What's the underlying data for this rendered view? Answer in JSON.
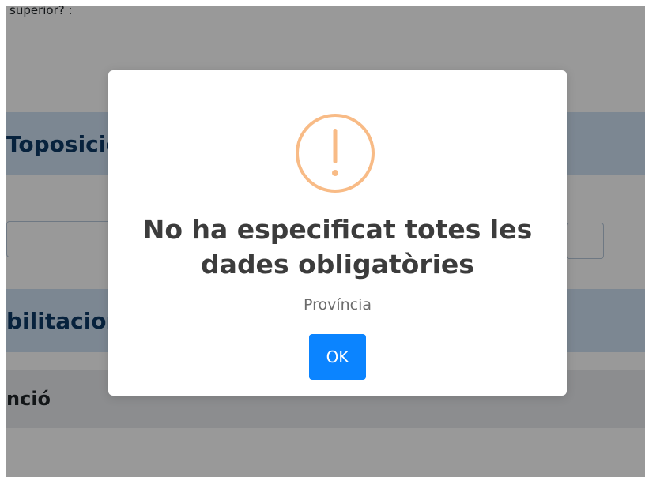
{
  "background": {
    "top_text": "superior? :",
    "section1_title": "Toposició",
    "section2_title": "bilitacion",
    "row_title": "nció"
  },
  "modal": {
    "icon": "exclamation-circle-icon",
    "title_line1": "No ha especificat totes les",
    "title_line2": "dades obligatòries",
    "text": "Província",
    "ok_label": "OK",
    "colors": {
      "icon": "#f8bb86",
      "button": "#0b84ff"
    }
  }
}
